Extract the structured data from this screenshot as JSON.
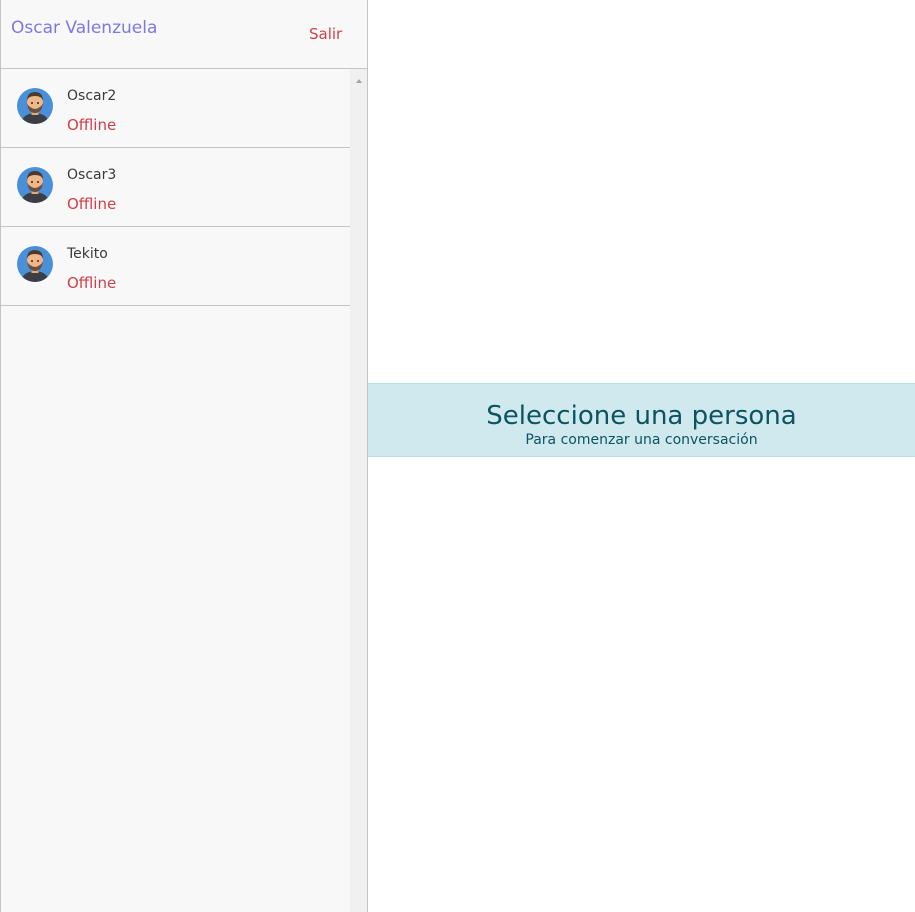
{
  "header": {
    "user_name": "Oscar Valenzuela",
    "logout_label": "Salir"
  },
  "contacts": [
    {
      "name": "Oscar2",
      "status": "Offline",
      "avatar_icon": "user-avatar-icon"
    },
    {
      "name": "Oscar3",
      "status": "Offline",
      "avatar_icon": "user-avatar-icon"
    },
    {
      "name": "Tekito",
      "status": "Offline",
      "avatar_icon": "user-avatar-icon"
    }
  ],
  "empty_chat": {
    "title": "Seleccione una persona",
    "subtitle": "Para comenzar una conversación"
  },
  "colors": {
    "user_name": "#7c79e6",
    "offline": "#cf3f49",
    "banner_bg": "#d0e9ef",
    "banner_text": "#0c5460"
  }
}
